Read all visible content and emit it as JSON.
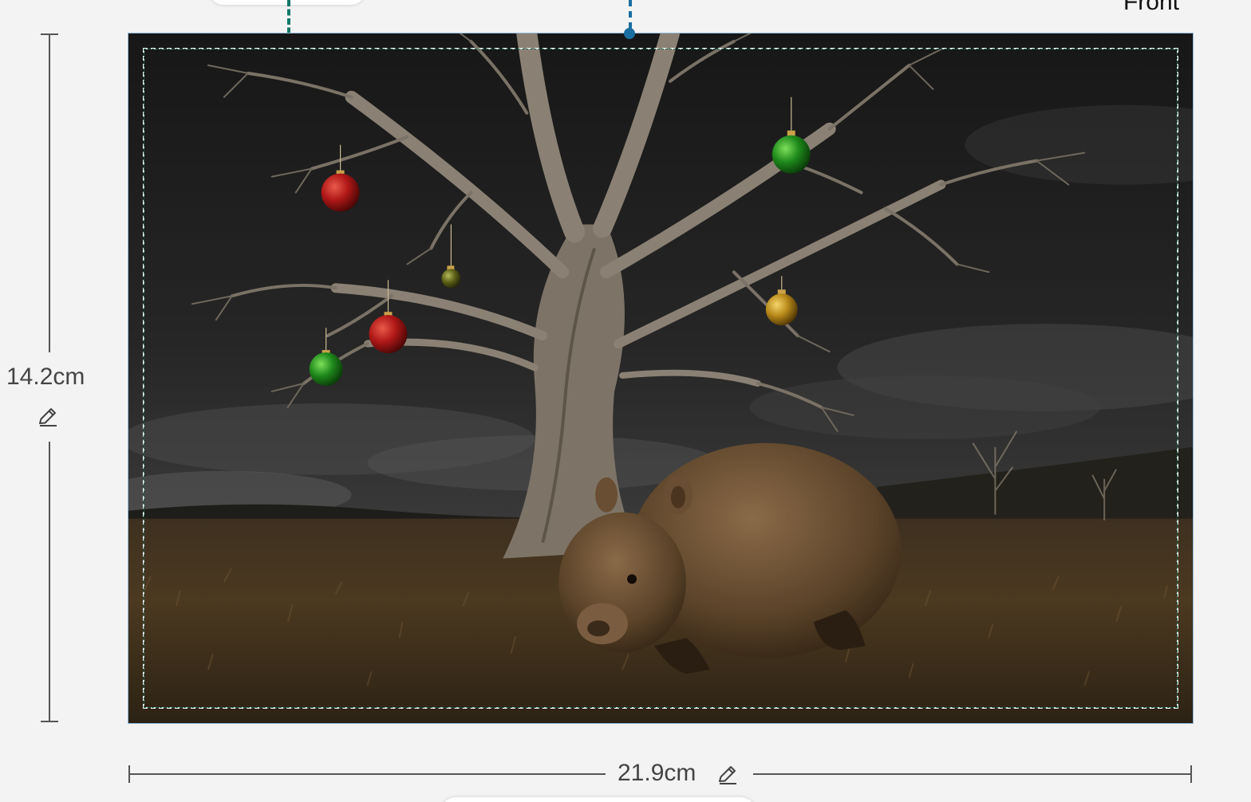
{
  "face_label": "Front",
  "dimensions": {
    "height_label": "14.2cm",
    "width_label": "21.9cm"
  },
  "colors": {
    "guide_green": "#14786a",
    "guide_blue": "#1a6fa0",
    "card_border": "#8fb6d6",
    "safe_zone": "#f0f0f0"
  },
  "icons": {
    "height_edit": "pencil-icon",
    "width_edit": "pencil-icon"
  }
}
